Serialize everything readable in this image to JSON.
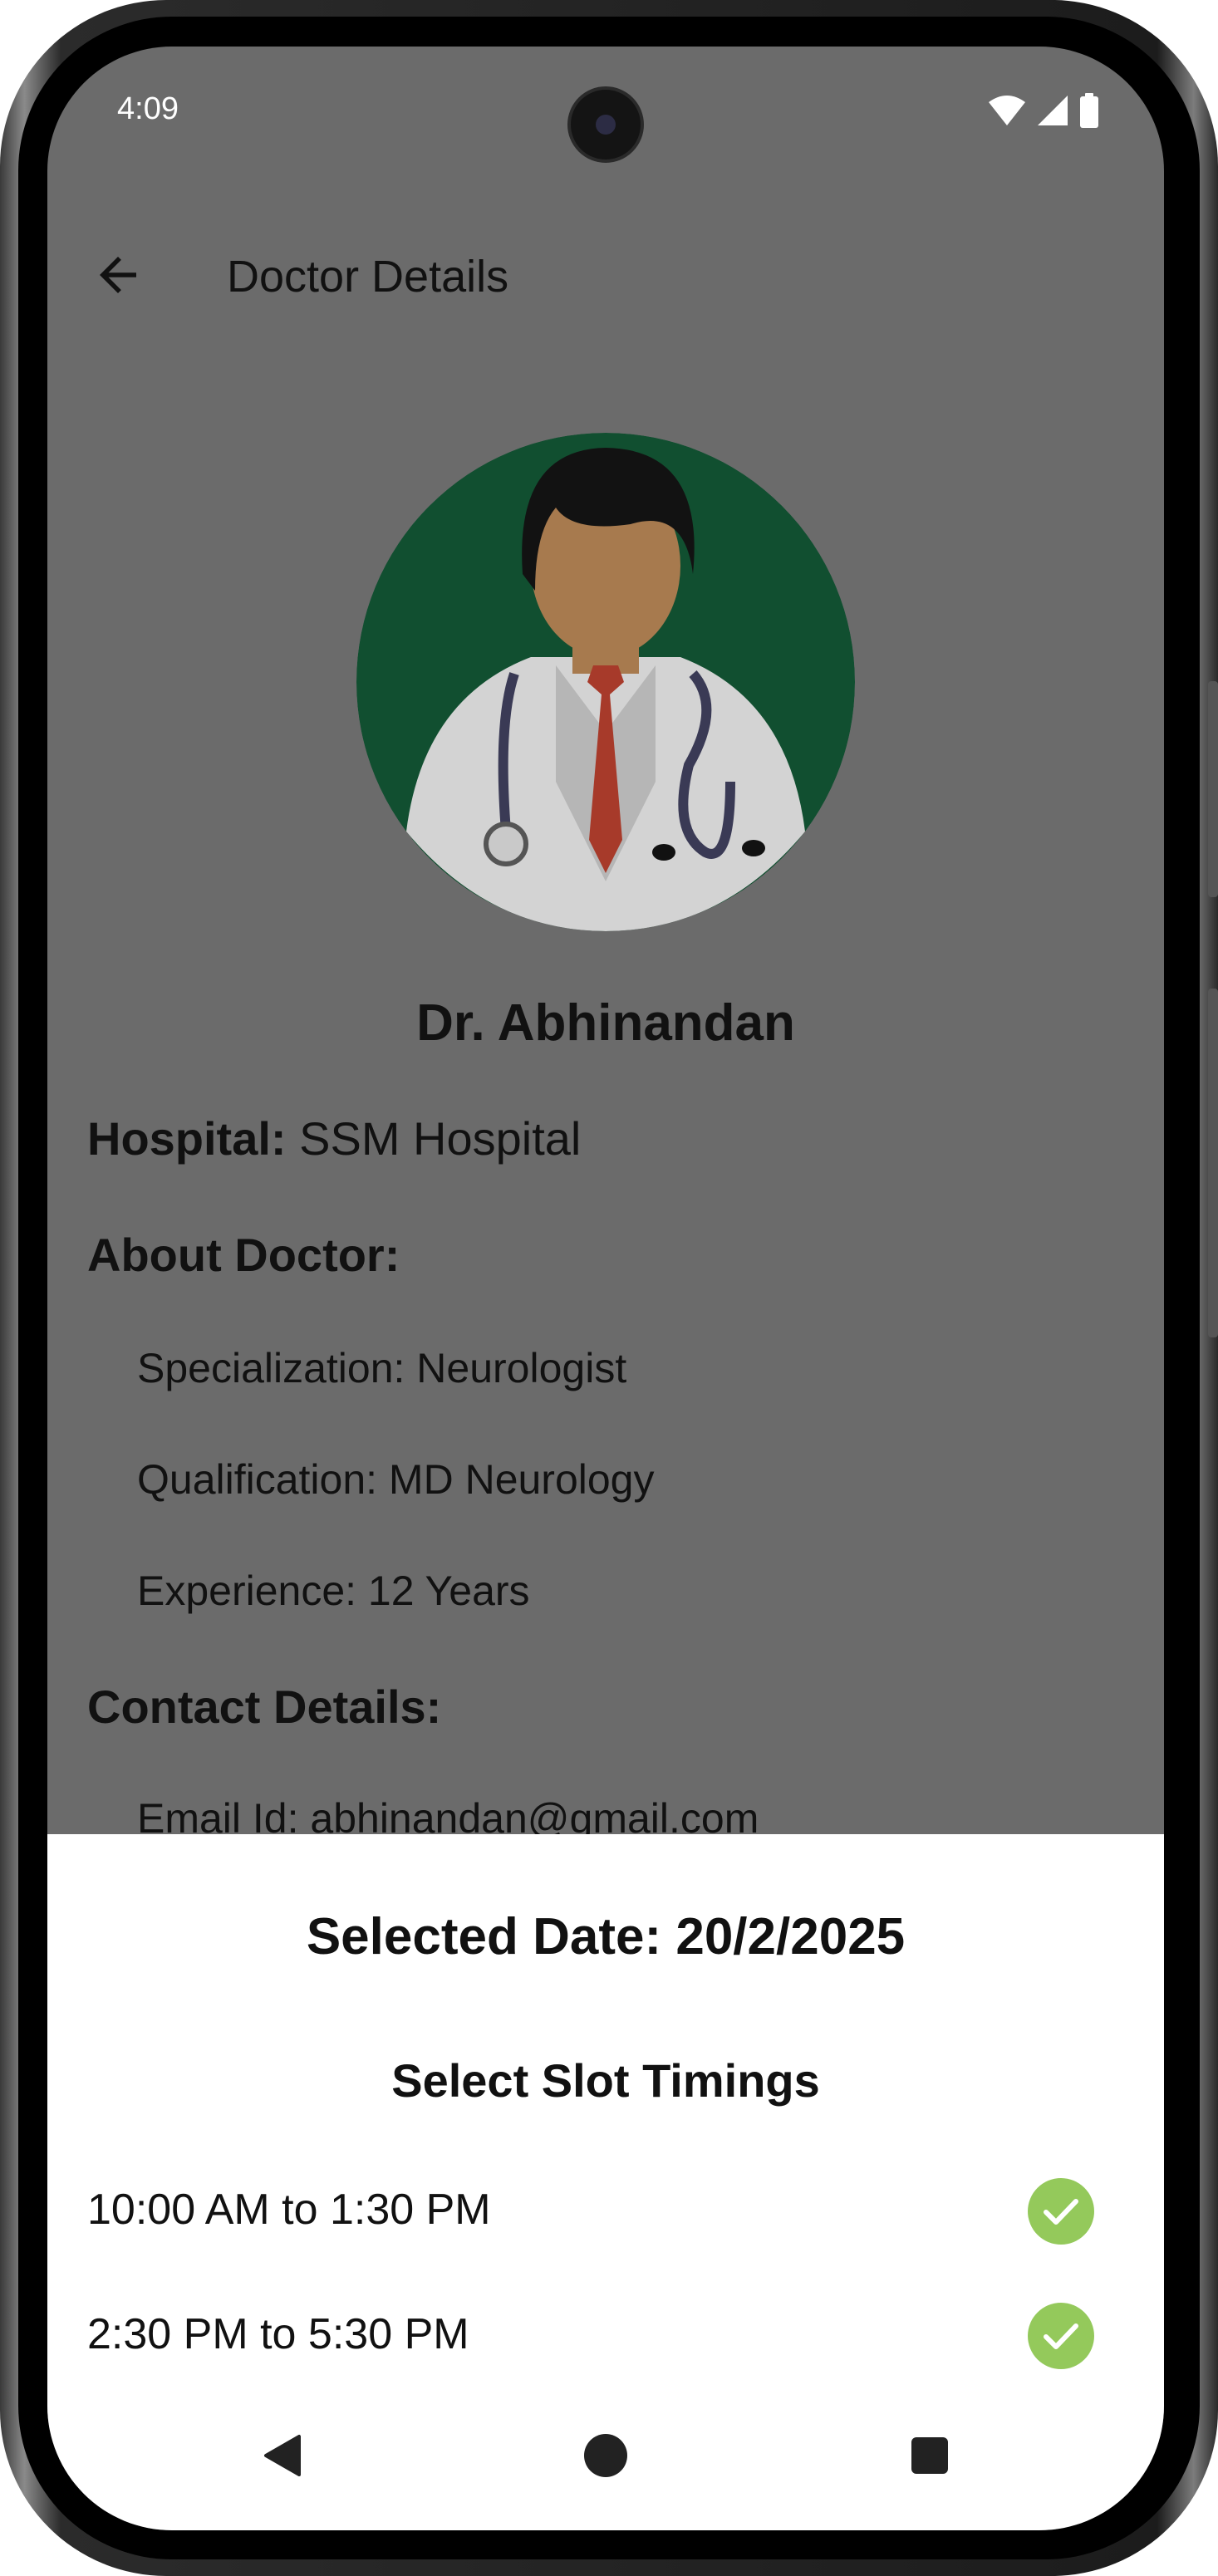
{
  "status": {
    "time": "4:09",
    "icons": [
      "wifi-icon",
      "signal-icon",
      "battery-icon"
    ]
  },
  "topbar": {
    "title": "Doctor Details",
    "back_icon": "arrow-left-icon"
  },
  "doctor": {
    "name": "Dr. Abhinandan",
    "hospital_label": "Hospital:",
    "hospital_value": "SSM Hospital",
    "about_heading": "About Doctor:",
    "specialization": "Specialization: Neurologist",
    "qualification": "Qualification: MD Neurology",
    "experience": "Experience: 12 Years",
    "contact_heading": "Contact Details:",
    "email": "Email Id: abhinandan@gmail.com"
  },
  "sheet": {
    "selected_date": "Selected Date: 20/2/2025",
    "subtitle": "Select Slot Timings",
    "slots": [
      {
        "label": "10:00 AM to 1:30 PM",
        "icon": "check-circle-icon"
      },
      {
        "label": "2:30 PM to 5:30 PM",
        "icon": "check-circle-icon"
      }
    ]
  },
  "navbar": {
    "buttons": [
      "back-triangle-icon",
      "home-circle-icon",
      "recents-square-icon"
    ]
  },
  "colors": {
    "scrim_background": "#6b6b6b",
    "sheet_background": "#ffffff",
    "check_green": "#94c95b",
    "avatar_bg": "#114f30",
    "tie_red": "#a73a2a"
  }
}
